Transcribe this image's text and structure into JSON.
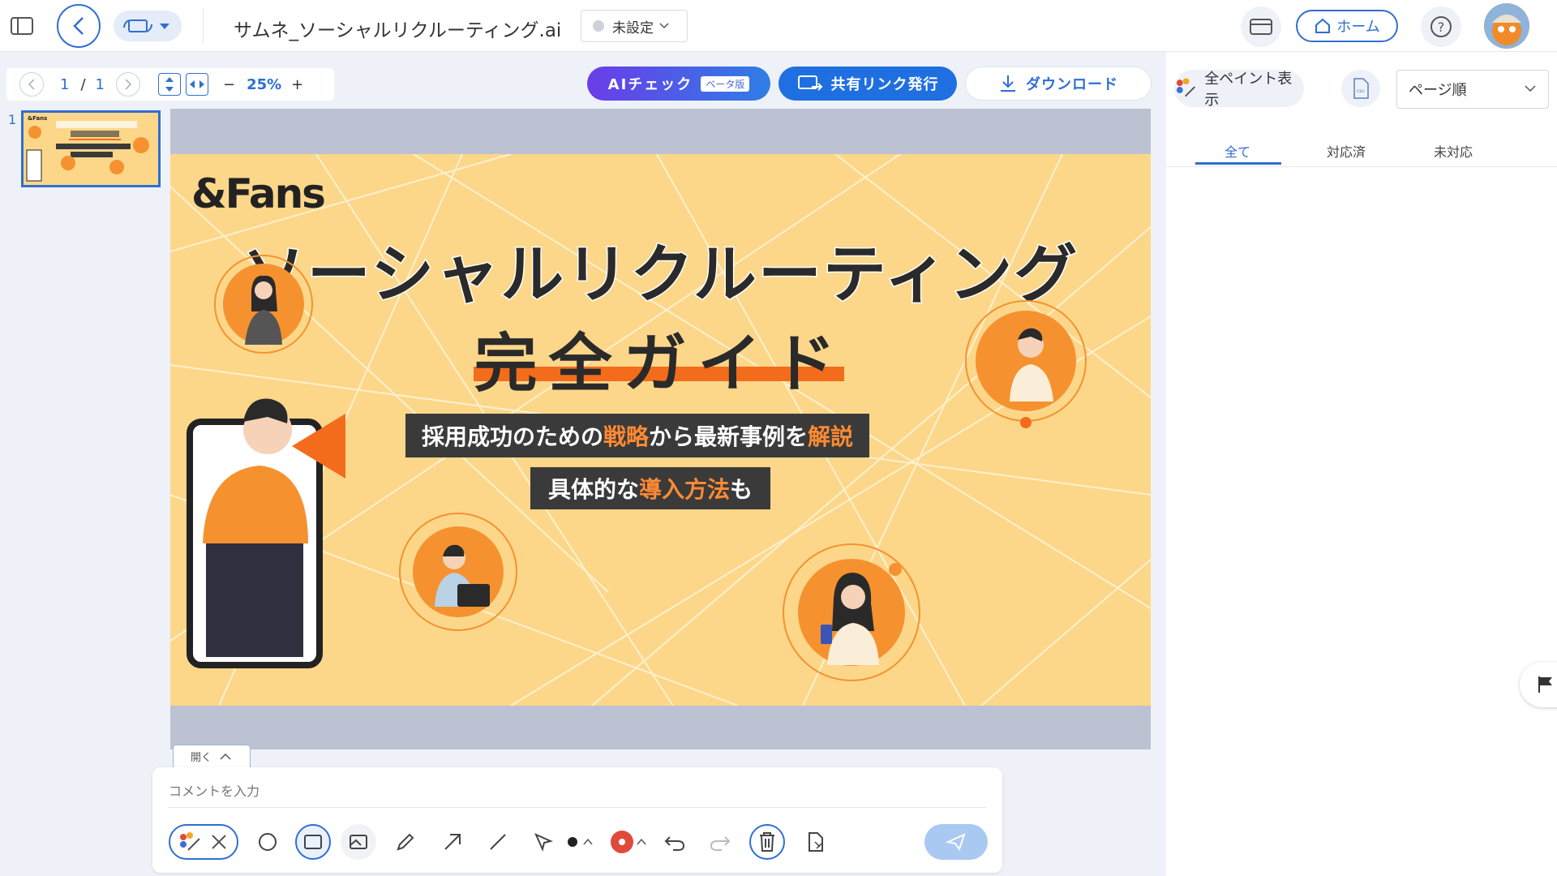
{
  "file": {
    "name": "サムネ_ソーシャルリクルーティング.ai",
    "status": "未設定"
  },
  "header": {
    "home_label": "ホーム"
  },
  "pager": {
    "current": "1",
    "separator": "/",
    "total": "1",
    "zoom": "25%"
  },
  "actions": {
    "ai_check": "AIチェック",
    "beta": "ベータ版",
    "share": "共有リンク発行",
    "download": "ダウンロード"
  },
  "thumbnails": [
    {
      "page": "1"
    }
  ],
  "artwork": {
    "logo": "&Fans",
    "title_line1": "ソーシャルリクルーティング",
    "title_line2": "完全ガイド",
    "sub1": {
      "a": "採用成功のための",
      "b": "戦略",
      "c": "から最新事例を",
      "d": "解説"
    },
    "sub2": {
      "a": "具体的な",
      "b": "導入方法",
      "c": "も"
    }
  },
  "comment": {
    "expand_label": "開く",
    "placeholder": "コメントを入力"
  },
  "right_panel": {
    "paint_label": "全ペイント表示",
    "sort_label": "ページ順",
    "tabs": [
      {
        "label": "全て"
      },
      {
        "label": "対応済"
      },
      {
        "label": "未対応"
      }
    ]
  },
  "colors": {
    "accent": "#2f6fd1",
    "brand_orange": "#f36c1c",
    "artboard_bg": "#fcd78a"
  }
}
